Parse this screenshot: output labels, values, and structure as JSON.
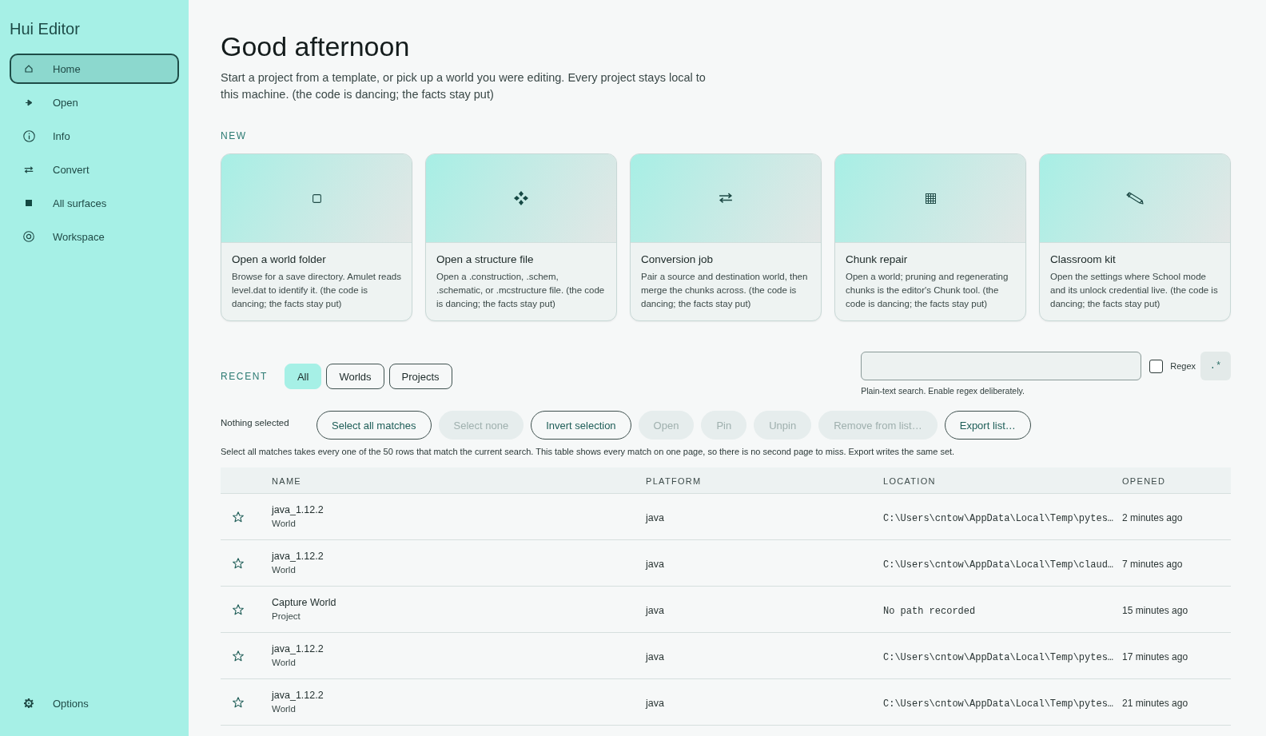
{
  "sidebar": {
    "title": "Hui Editor",
    "items": [
      {
        "label": "Home",
        "selected": true
      },
      {
        "label": "Open",
        "selected": false
      },
      {
        "label": "Info",
        "selected": false
      },
      {
        "label": "Convert",
        "selected": false
      },
      {
        "label": "All surfaces",
        "selected": false
      },
      {
        "label": "Workspace",
        "selected": false
      }
    ],
    "footer_items": [
      {
        "label": "Options",
        "selected": false
      }
    ]
  },
  "header": {
    "title": "Good afternoon",
    "subtitle": "Start a project from a template, or pick up a world you were editing. Every project stays local to this machine. (the code is dancing; the facts stay put)"
  },
  "new_section": {
    "label": "NEW",
    "cards": [
      {
        "title": "Open a world folder",
        "description": "Browse for a save directory. Amulet reads level.dat to identify it. (the code is dancing; the facts stay put)"
      },
      {
        "title": "Open a structure file",
        "description": "Open a .construction, .schem, .schematic, or .mcstructure file. (the code is dancing; the facts stay put)"
      },
      {
        "title": "Conversion job",
        "description": "Pair a source and destination world, then merge the chunks across. (the code is dancing; the facts stay put)"
      },
      {
        "title": "Chunk repair",
        "description": "Open a world; pruning and regenerating chunks is the editor's Chunk tool. (the code is dancing; the facts stay put)"
      },
      {
        "title": "Classroom kit",
        "description": "Open the settings where School mode and its unlock credential live. (the code is dancing; the facts stay put)"
      }
    ]
  },
  "recent": {
    "label": "RECENT",
    "filters": [
      {
        "label": "All",
        "selected": true
      },
      {
        "label": "Worlds",
        "selected": false
      },
      {
        "label": "Projects",
        "selected": false
      }
    ],
    "search": {
      "hint": "Plain-text search. Enable regex deliberately.",
      "regex": {
        "label": "Regex",
        "checked": false
      },
      "regex_button": ".*"
    }
  },
  "selection": {
    "status": "Nothing selected",
    "buttons": [
      {
        "label": "Select all matches",
        "disabled": false
      },
      {
        "label": "Select none",
        "disabled": true
      },
      {
        "label": "Invert selection",
        "disabled": false
      },
      {
        "label": "Open",
        "disabled": true
      },
      {
        "label": "Pin",
        "disabled": true
      },
      {
        "label": "Unpin",
        "disabled": true
      },
      {
        "label": "Remove from list…",
        "disabled": true
      },
      {
        "label": "Export list…",
        "disabled": false
      }
    ],
    "note": "Select all matches takes every one of the 50 rows that match the current search. This table shows every match on one page, so there is no second page to miss. Export writes the same set."
  },
  "table": {
    "columns": [
      "NAME",
      "PLATFORM",
      "LOCATION",
      "OPENED"
    ],
    "rows": [
      {
        "pinned": false,
        "name": "java_1.12.2",
        "type": "World",
        "platform": "java",
        "location": "C:\\Users\\cntow\\AppData\\Local\\Temp\\pytes…",
        "opened": "2 minutes ago"
      },
      {
        "pinned": false,
        "name": "java_1.12.2",
        "type": "World",
        "platform": "java",
        "location": "C:\\Users\\cntow\\AppData\\Local\\Temp\\claud…",
        "opened": "7 minutes ago"
      },
      {
        "pinned": false,
        "name": "Capture World",
        "type": "Project",
        "platform": "java",
        "location": "No path recorded",
        "opened": "15 minutes ago"
      },
      {
        "pinned": false,
        "name": "java_1.12.2",
        "type": "World",
        "platform": "java",
        "location": "C:\\Users\\cntow\\AppData\\Local\\Temp\\pytes…",
        "opened": "17 minutes ago"
      },
      {
        "pinned": false,
        "name": "java_1.12.2",
        "type": "World",
        "platform": "java",
        "location": "C:\\Users\\cntow\\AppData\\Local\\Temp\\pytes…",
        "opened": "21 minutes ago"
      }
    ]
  }
}
